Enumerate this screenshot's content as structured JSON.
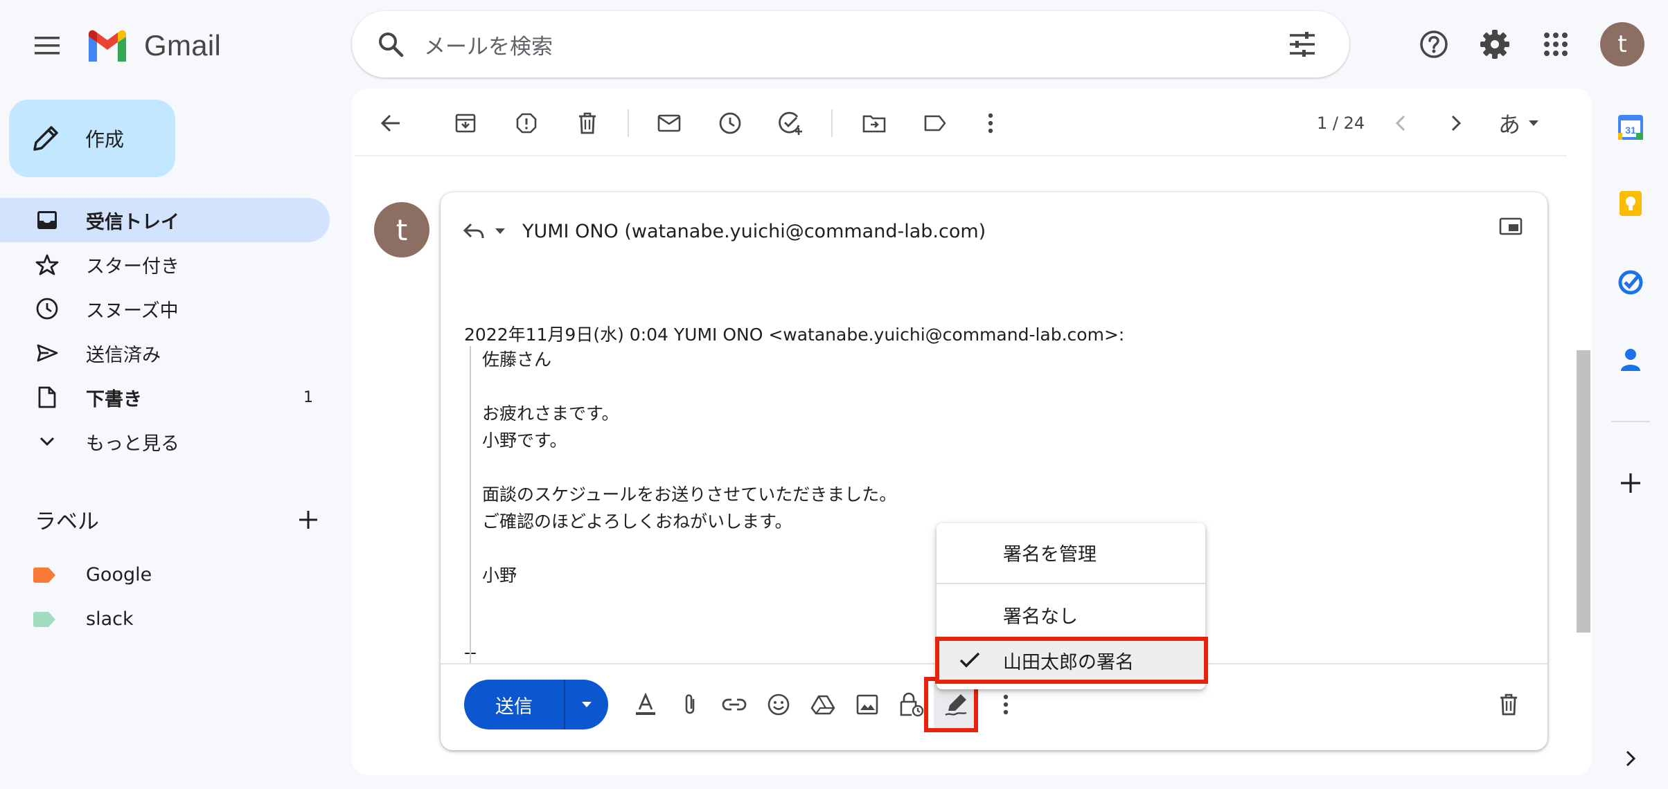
{
  "header": {
    "app_name": "Gmail",
    "search_placeholder": "メールを検索",
    "avatar_letter": "t"
  },
  "nav": {
    "compose_label": "作成",
    "items": [
      {
        "label": "受信トレイ",
        "count": "",
        "active": true
      },
      {
        "label": "スター付き",
        "count": ""
      },
      {
        "label": "スヌーズ中",
        "count": ""
      },
      {
        "label": "送信済み",
        "count": ""
      },
      {
        "label": "下書き",
        "count": "1"
      },
      {
        "label": "もっと見る",
        "count": ""
      }
    ],
    "labels_heading": "ラベル",
    "labels": [
      {
        "name": "Google",
        "color": "#f97a36"
      },
      {
        "name": "slack",
        "color": "#a2dcc1"
      }
    ]
  },
  "toolbar": {
    "page_count": "1 / 24",
    "input_tool": "あ"
  },
  "message": {
    "sender_avatar": "t",
    "reply_to": "YUMI ONO (watanabe.yuichi@command-lab.com)",
    "quote_header": "2022年11月9日(水) 0:04 YUMI ONO <watanabe.yuichi@command-lab.com>:",
    "quote_lines": [
      "佐藤さん",
      "",
      "お疲れさまです。",
      "小野です。",
      "",
      "面談のスケジュールをお送りさせていただきました。",
      "ご確認のほどよろしくおねがいします。",
      "",
      "小野"
    ],
    "signature_separator": "--"
  },
  "compose_bar": {
    "send_label": "送信"
  },
  "signature_menu": {
    "manage": "署名を管理",
    "none": "署名なし",
    "selected": "山田太郎の署名"
  },
  "colors": {
    "accent": "#0b57d0",
    "highlight_red": "#e8230d",
    "active_nav": "#d3e3fd",
    "compose_bg": "#c2e7ff"
  }
}
